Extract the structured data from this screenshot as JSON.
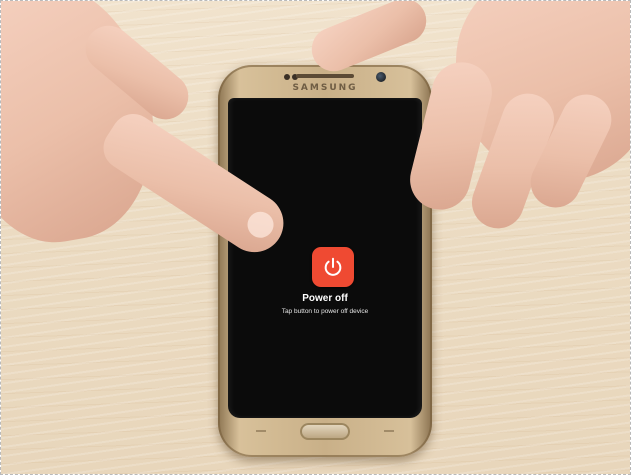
{
  "phone": {
    "brand": "SAMSUNG"
  },
  "dialog": {
    "title": "Power off",
    "subtitle": "Tap button to power off device",
    "icon": "power-icon",
    "icon_color": "#ef4a32"
  },
  "colors": {
    "screen": "#0b0b0b",
    "table": "#ecdcc3"
  }
}
